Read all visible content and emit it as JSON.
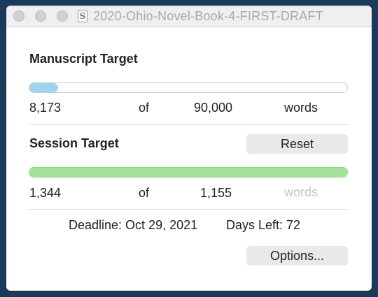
{
  "window": {
    "title": "2020-Ohio-Novel-Book-4-FIRST-DRAFT",
    "doc_icon_glyph": "S"
  },
  "manuscript": {
    "heading": "Manuscript Target",
    "current": "8,173",
    "of_label": "of",
    "target": "90,000",
    "unit": "words",
    "progress_fraction": 0.0908,
    "fill_color": "#9fd3f2"
  },
  "session": {
    "heading": "Session Target",
    "reset_label": "Reset",
    "current": "1,344",
    "of_label": "of",
    "target": "1,155",
    "unit": "words",
    "progress_fraction": 1.0,
    "fill_color": "#a6e39a"
  },
  "footer": {
    "deadline": "Deadline: Oct 29, 2021",
    "days_left": "Days Left: 72",
    "options_label": "Options..."
  }
}
